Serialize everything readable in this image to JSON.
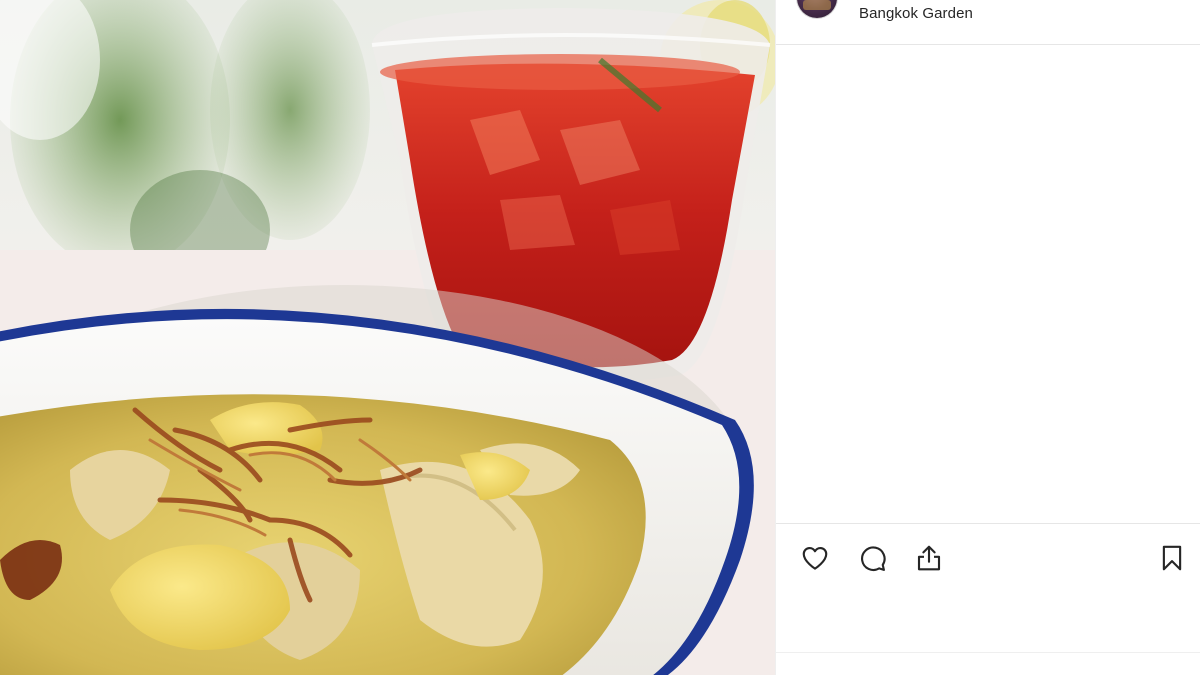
{
  "post": {
    "username": "Bangkok Garden"
  },
  "actions": {
    "like_icon": "heart-icon",
    "comment_icon": "comment-icon",
    "share_icon": "share-icon",
    "save_icon": "bookmark-icon"
  },
  "colors": {
    "text": "#262626",
    "divider": "#e6e6e6",
    "bowl_rim": "#1f3a9a",
    "curry": "#d9c25a",
    "tea": "#c8231a"
  }
}
